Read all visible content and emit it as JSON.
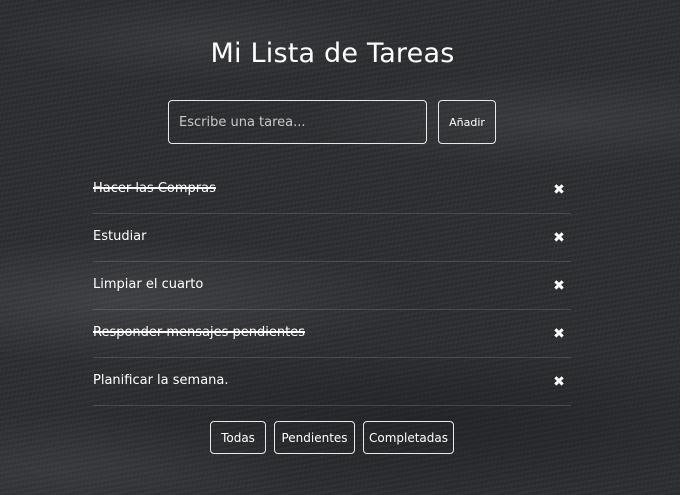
{
  "title": "Mi Lista de Tareas",
  "input": {
    "value": "",
    "placeholder": "Escribe una tarea..."
  },
  "add_button_label": "Añadir",
  "tasks": [
    {
      "text": "Hacer las Compras",
      "completed": true,
      "delete_icon": "close-icon"
    },
    {
      "text": "Estudiar",
      "completed": false,
      "delete_icon": "close-icon"
    },
    {
      "text": "Limpiar el cuarto",
      "completed": false,
      "delete_icon": "close-icon"
    },
    {
      "text": "Responder mensajes pendientes",
      "completed": true,
      "delete_icon": "close-icon"
    },
    {
      "text": "Planificar la semana.",
      "completed": false,
      "delete_icon": "close-icon"
    }
  ],
  "filters": {
    "all": "Todas",
    "pending": "Pendientes",
    "completed": "Completadas"
  },
  "colors": {
    "text": "#ffffff",
    "border": "#e8e8e8",
    "background": "#2b2d31"
  }
}
